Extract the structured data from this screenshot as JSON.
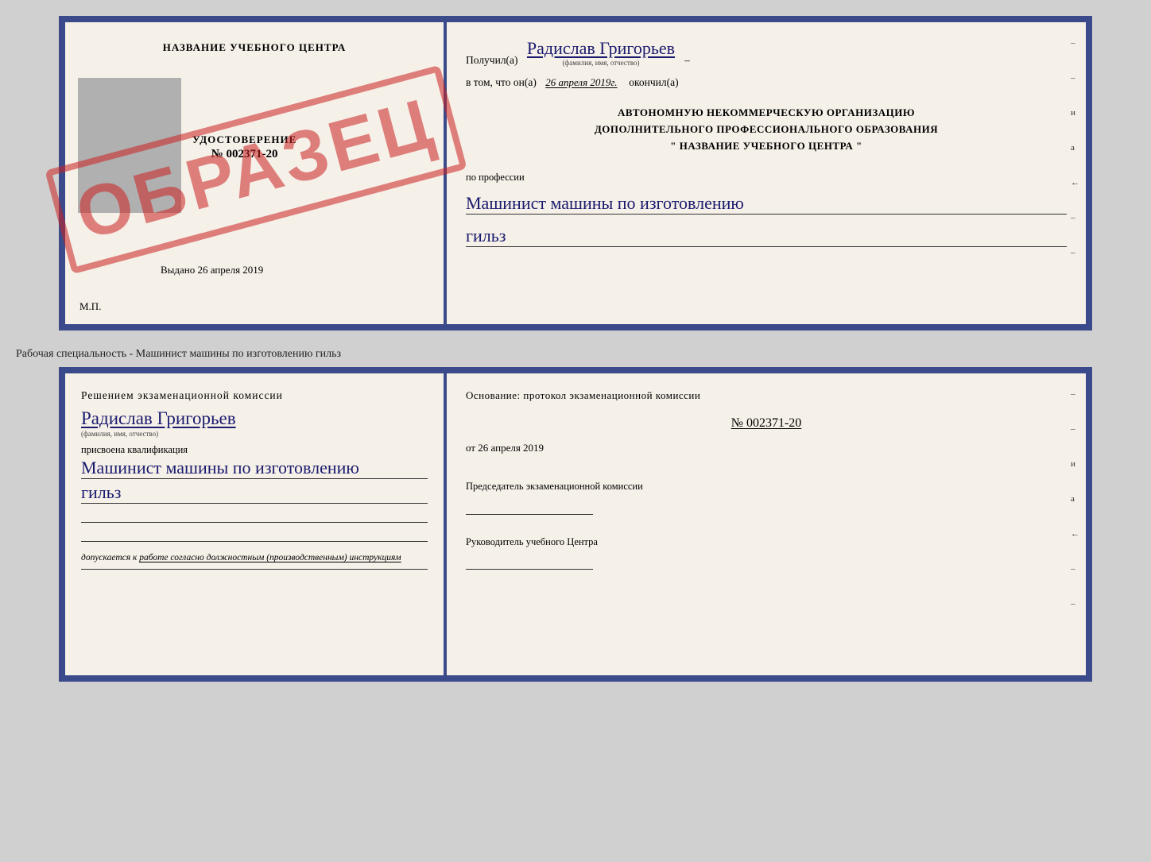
{
  "page": {
    "background_color": "#d0d0d0"
  },
  "top_doc": {
    "left": {
      "header": "НАЗВАНИЕ УЧЕБНОГО ЦЕНТРА",
      "stamp_text": "ОБРАЗЕЦ",
      "udostoverenie_title": "УДОСТОВЕРЕНИЕ",
      "udostoverenie_number": "№ 002371-20",
      "vydano_label": "Выдано",
      "vydano_date": "26 апреля 2019",
      "mp_label": "М.П."
    },
    "right": {
      "poluchil_label": "Получил(а)",
      "recipient_name": "Радислав Григорьев",
      "fio_label": "(фамилия, имя, отчество)",
      "vtom_label": "в том, что он(а)",
      "date_value": "26 апреля 2019г.",
      "okonchil_label": "окончил(а)",
      "center_line1": "АВТОНОМНУЮ НЕКОММЕРЧЕСКУЮ ОРГАНИЗАЦИЮ",
      "center_line2": "ДОПОЛНИТЕЛЬНОГО ПРОФЕССИОНАЛЬНОГО ОБРАЗОВАНИЯ",
      "center_line3": "\"   НАЗВАНИЕ УЧЕБНОГО ЦЕНТРА   \"",
      "po_professii_label": "по профессии",
      "profession_line1": "Машинист машины по изготовлению",
      "profession_line2": "гильз",
      "right_letters": [
        "и",
        "а",
        "←",
        "−",
        "−",
        "−",
        "−"
      ]
    }
  },
  "separator": {
    "text": "Рабочая специальность - Машинист машины по изготовлению гильз"
  },
  "bottom_doc": {
    "left": {
      "heading": "Решением  экзаменационной  комиссии",
      "recipient_name": "Радислав Григорьев",
      "fio_label": "(фамилия, имя, отчество)",
      "prisvoena_label": "присвоена квалификация",
      "profession_line1": "Машинист  машины  по  изготовлению",
      "profession_line2": "гильз",
      "dopuskaetsya_label": "допускается к",
      "dopuskaetsya_text": "работе согласно должностным (производственным) инструкциям"
    },
    "right": {
      "osnov_label": "Основание: протокол экзаменационной  комиссии",
      "osnov_number": "№  002371-20",
      "osnov_ot_label": "от",
      "osnov_date": "26 апреля 2019",
      "predsedatel_label": "Председатель экзаменационной комиссии",
      "rukovoditel_label": "Руководитель учебного Центра",
      "right_letters": [
        "и",
        "а",
        "←",
        "−",
        "−",
        "−",
        "−"
      ]
    }
  }
}
